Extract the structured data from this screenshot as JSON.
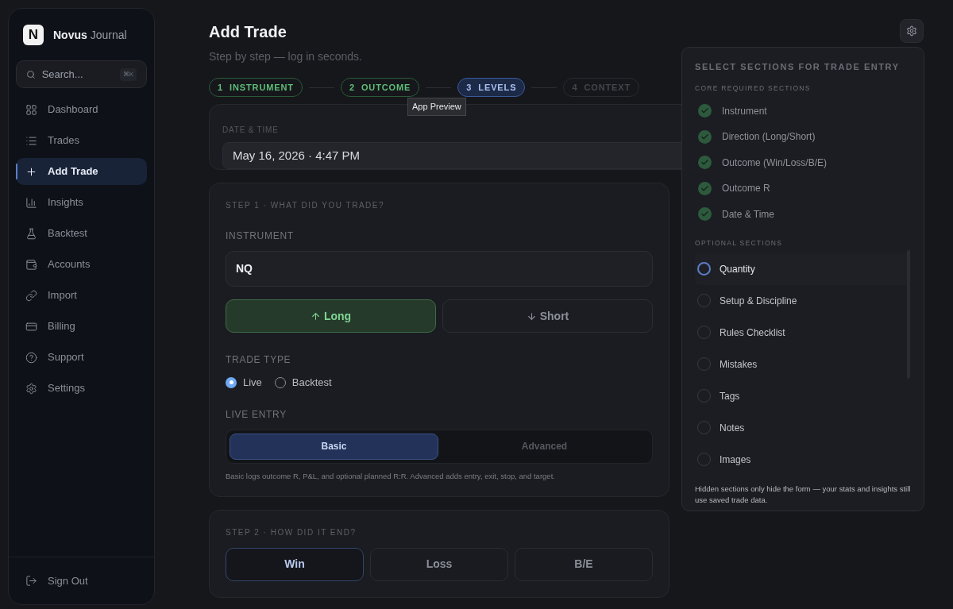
{
  "sidebar": {
    "logo_letter": "N",
    "brand_name": "Novus",
    "brand_suffix": "Journal",
    "search": {
      "placeholder": "Search...",
      "shortcut": "⌘K"
    },
    "items": [
      {
        "label": "Dashboard",
        "selected": false
      },
      {
        "label": "Trades",
        "selected": false
      },
      {
        "label": "Add Trade",
        "selected": true
      },
      {
        "label": "Insights",
        "selected": false
      },
      {
        "label": "Backtest",
        "selected": false
      },
      {
        "label": "Accounts",
        "selected": false
      },
      {
        "label": "Import",
        "selected": false
      },
      {
        "label": "Billing",
        "selected": false
      },
      {
        "label": "Support",
        "selected": false
      },
      {
        "label": "Settings",
        "selected": false
      }
    ],
    "sign_out": "Sign Out"
  },
  "header": {
    "title": "Add Trade",
    "subtitle": "Step by step — log in seconds."
  },
  "steps": [
    {
      "number": "1",
      "label": "INSTRUMENT",
      "completed": true,
      "selected": false
    },
    {
      "number": "2",
      "label": "OUTCOME",
      "completed": true,
      "selected": false
    },
    {
      "number": "3",
      "label": "LEVELS",
      "completed": false,
      "selected": true
    },
    {
      "number": "4",
      "label": "CONTEXT",
      "completed": false,
      "selected": false
    }
  ],
  "tooltip": "App Preview",
  "date_card": {
    "label": "DATE & TIME",
    "value": "May 16, 2026 · 4:47 PM"
  },
  "step1": {
    "heading": "STEP 1 · WHAT DID YOU TRADE?",
    "instrument_label": "INSTRUMENT",
    "instrument_value": "NQ",
    "directions": [
      {
        "label": "Long",
        "kind": "long",
        "selected": true
      },
      {
        "label": "Short",
        "kind": "short",
        "selected": false
      }
    ],
    "trade_type_label": "TRADE TYPE",
    "trade_types": [
      {
        "label": "Live",
        "selected": true
      },
      {
        "label": "Backtest",
        "selected": false
      }
    ],
    "entry_label": "LIVE ENTRY",
    "entry_modes": [
      {
        "label": "Basic",
        "selected": true
      },
      {
        "label": "Advanced",
        "selected": false
      }
    ],
    "help": "Basic logs outcome R, P&L, and optional planned R:R. Advanced adds entry, exit, stop, and target."
  },
  "step2": {
    "heading": "STEP 2 · HOW DID IT END?",
    "outcomes": [
      {
        "label": "Win",
        "selected": true
      },
      {
        "label": "Loss",
        "selected": false
      },
      {
        "label": "B/E",
        "selected": false
      }
    ]
  },
  "sections_popover": {
    "title": "SELECT SECTIONS FOR TRADE ENTRY",
    "core_heading": "CORE REQUIRED SECTIONS",
    "core": [
      {
        "label": "Instrument",
        "checked": true
      },
      {
        "label": "Direction (Long/Short)",
        "checked": true
      },
      {
        "label": "Outcome (Win/Loss/B/E)",
        "checked": true
      },
      {
        "label": "Outcome R",
        "checked": true
      },
      {
        "label": "Date & Time",
        "checked": true
      }
    ],
    "optional_heading": "OPTIONAL SECTIONS",
    "optional": [
      {
        "label": "Quantity",
        "checked": false,
        "selected": true
      },
      {
        "label": "Setup & Discipline",
        "checked": false,
        "selected": false
      },
      {
        "label": "Rules Checklist",
        "checked": false,
        "selected": false
      },
      {
        "label": "Mistakes",
        "checked": false,
        "selected": false
      },
      {
        "label": "Tags",
        "checked": false,
        "selected": false
      },
      {
        "label": "Notes",
        "checked": false,
        "selected": false
      },
      {
        "label": "Images",
        "checked": false,
        "selected": false
      }
    ],
    "footnote": "Hidden sections only hide the form — your stats and insights still use saved trade data."
  }
}
